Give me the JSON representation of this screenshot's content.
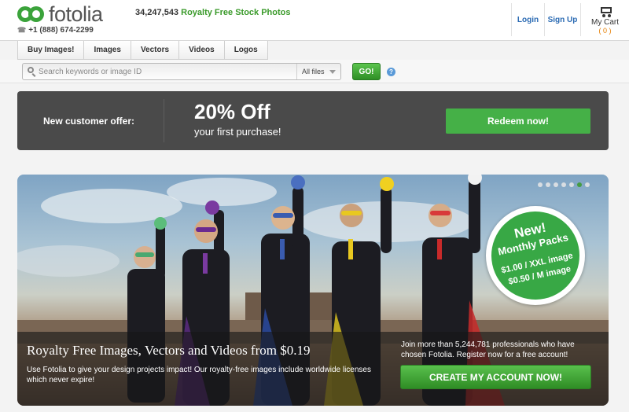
{
  "header": {
    "logo_text": "fotolia",
    "phone": "+1 (888) 674-2299",
    "stock_count": "34,247,543",
    "stock_label": "Royalty Free Stock Photos",
    "login": "Login",
    "signup": "Sign Up",
    "cart_label": "My Cart",
    "cart_count": "( 0 )"
  },
  "menu": {
    "items": [
      "Buy Images!",
      "Images",
      "Vectors",
      "Videos",
      "Logos"
    ]
  },
  "search": {
    "placeholder": "Search keywords or image ID",
    "filter_selected": "All files",
    "go_label": "GO!",
    "help": "?"
  },
  "offer": {
    "label": "New customer offer:",
    "headline": "20% Off",
    "subline": "your first purchase!",
    "button": "Redeem now!"
  },
  "hero": {
    "title": "Royalty Free Images, Vectors and Videos from $0.19",
    "description": "Use Fotolia to give your design projects impact! Our royalty-free images include worldwide licenses which never expire!",
    "join_text": "Join more than 5,244,781 professionals who have chosen Fotolia. Register now for a free account!",
    "cta": "CREATE MY ACCOUNT NOW!",
    "slides": 7,
    "active_slide": 6,
    "badge": {
      "new": "New!",
      "monthly": "Monthly Packs",
      "price_xxl": "$1.00 / XXL image",
      "price_m": "$0.50 / M image"
    }
  },
  "colors": {
    "brand_green": "#3ba33b",
    "offer_bg": "#4a4a4a",
    "link_blue": "#2a6ab3"
  }
}
